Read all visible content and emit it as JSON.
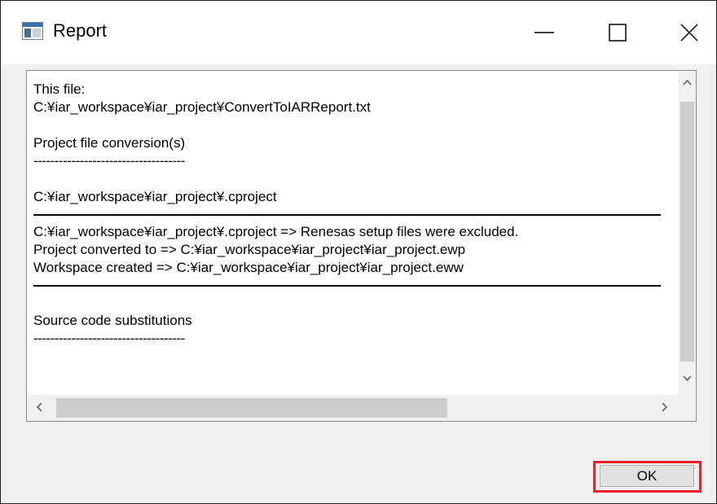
{
  "window": {
    "title": "Report",
    "controls": [
      "minimize",
      "maximize",
      "close"
    ]
  },
  "report": {
    "lines_before_sep1": [
      "This file:",
      "C:¥iar_workspace¥iar_project¥ConvertToIARReport.txt",
      "",
      "Project file conversion(s)",
      "------------------------------------",
      "",
      "C:¥iar_workspace¥iar_project¥.cproject"
    ],
    "lines_between_seps": [
      "C:¥iar_workspace¥iar_project¥.cproject => Renesas setup files were excluded.",
      "Project converted to => C:¥iar_workspace¥iar_project¥iar_project.ewp",
      "Workspace created => C:¥iar_workspace¥iar_project¥iar_project.eww"
    ],
    "lines_after_sep2": [
      "",
      "Source code substitutions",
      "------------------------------------"
    ]
  },
  "buttons": {
    "ok_label": "OK"
  },
  "colors": {
    "highlight": "#e8202a",
    "window_bg": "#f0f0f0",
    "scroll_thumb": "#cdcdcd"
  },
  "icons": [
    "app-window-icon",
    "minimize-icon",
    "maximize-icon",
    "close-icon",
    "chevron-up-icon",
    "chevron-down-icon",
    "chevron-left-icon",
    "chevron-right-icon"
  ]
}
